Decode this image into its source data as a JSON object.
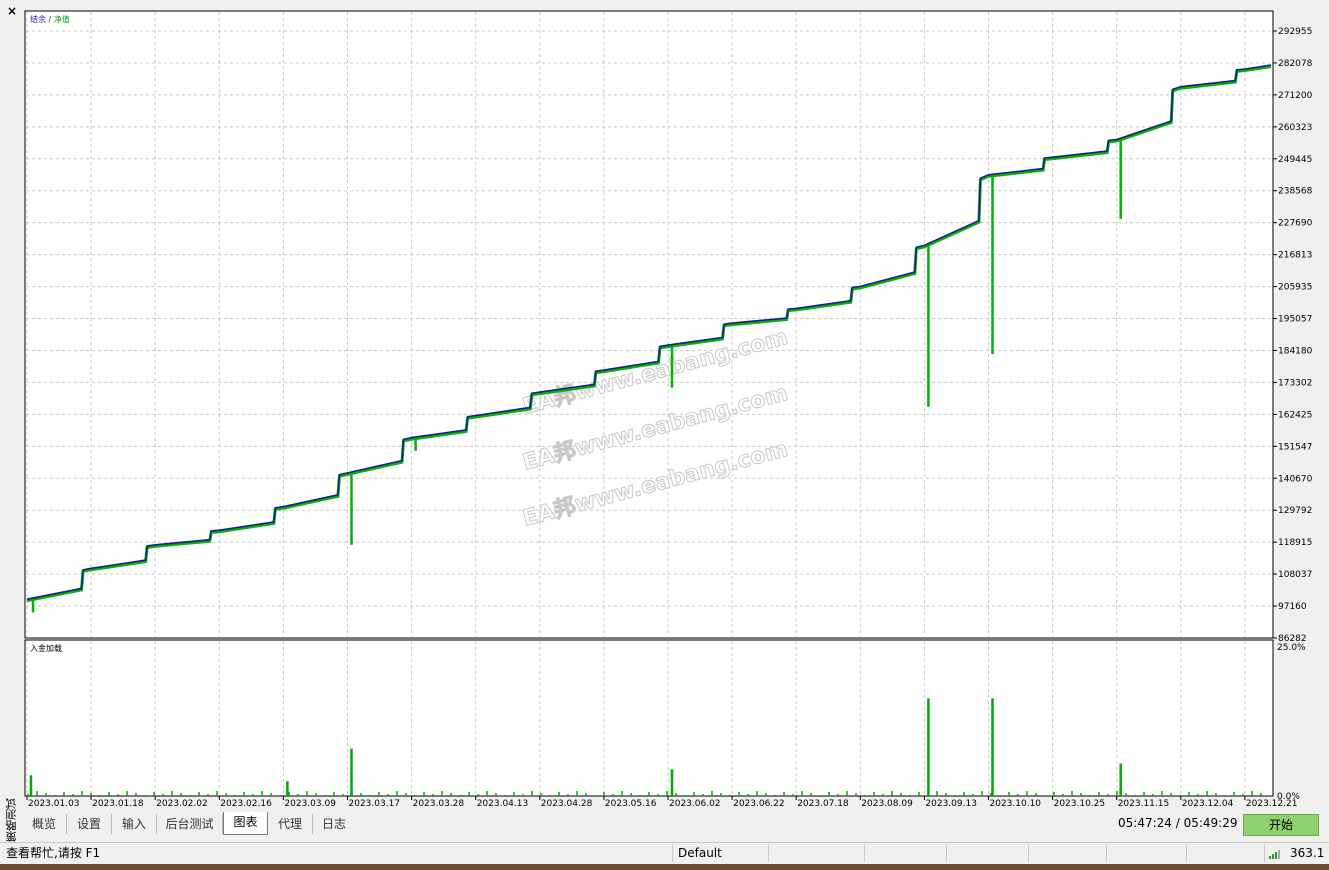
{
  "window": {
    "close_glyph": "×",
    "side_label": "策略测试"
  },
  "balance_chart": {
    "legend_balance": "结余",
    "legend_sep": " / ",
    "legend_equity": "净值",
    "y_ticks": [
      "292955",
      "282078",
      "271200",
      "260323",
      "249445",
      "238568",
      "227690",
      "216813",
      "205935",
      "195057",
      "184180",
      "173302",
      "162425",
      "151547",
      "140670",
      "129792",
      "118915",
      "108037",
      "97160",
      "86282"
    ]
  },
  "deposit_chart": {
    "title": "入金加载",
    "y_top": "25.0%",
    "y_bottom": "0.0%"
  },
  "x_ticks": [
    "2023.01.03",
    "2023.01.18",
    "2023.02.02",
    "2023.02.16",
    "2023.03.09",
    "2023.03.17",
    "2023.03.28",
    "2023.04.13",
    "2023.04.28",
    "2023.05.16",
    "2023.06.02",
    "2023.06.22",
    "2023.07.18",
    "2023.08.09",
    "2023.09.13",
    "2023.10.10",
    "2023.10.25",
    "2023.11.15",
    "2023.12.04",
    "2023.12.21"
  ],
  "watermark": [
    "EA邦www.eabang.com",
    "EA邦www.eabang.com",
    "EA邦www.eabang.com"
  ],
  "colors": {
    "balance": "#1a1a9a",
    "equity": "#00b400",
    "deposit": "#00aa00",
    "grid": "#c8c8c8",
    "start_button": "#8dd06d"
  },
  "tabs": [
    "概览",
    "设置",
    "输入",
    "后台测试",
    "图表",
    "代理",
    "日志"
  ],
  "active_tab": "图表",
  "time_readout": "05:47:24 / 05:49:29",
  "start_button": "开始",
  "statusbar": {
    "help": "查看帮忙,请按 F1",
    "profile": "Default",
    "signal": "363.1"
  },
  "chart_data": [
    {
      "type": "line",
      "title": "",
      "legend": [
        "结余",
        "净值"
      ],
      "ylim": [
        86282,
        292955
      ],
      "x_ticks": [
        "2023.01.03",
        "2023.01.18",
        "2023.02.02",
        "2023.02.16",
        "2023.03.09",
        "2023.03.17",
        "2023.03.28",
        "2023.04.13",
        "2023.04.28",
        "2023.05.16",
        "2023.06.02",
        "2023.06.22",
        "2023.07.18",
        "2023.08.09",
        "2023.09.13",
        "2023.10.10",
        "2023.10.25",
        "2023.11.15",
        "2023.12.04",
        "2023.12.21"
      ],
      "series": [
        {
          "name": "结余",
          "x": [
            "2023.01.03",
            "2023.01.18",
            "2023.02.02",
            "2023.02.16",
            "2023.03.09",
            "2023.03.17",
            "2023.03.28",
            "2023.04.13",
            "2023.04.28",
            "2023.05.16",
            "2023.06.02",
            "2023.06.22",
            "2023.07.18",
            "2023.08.09",
            "2023.09.13",
            "2023.10.10",
            "2023.10.25",
            "2023.11.15",
            "2023.12.04",
            "2023.12.21"
          ],
          "values": [
            99500,
            110000,
            118000,
            123000,
            131000,
            142500,
            154500,
            162000,
            170000,
            177500,
            186000,
            193500,
            198500,
            206000,
            220000,
            244000,
            250000,
            256000,
            274000,
            280000
          ]
        },
        {
          "name": "净值",
          "drawdown_lows": [
            {
              "x": "2023.01.03",
              "value": 95000
            },
            {
              "x": "2023.03.17",
              "value": 118000
            },
            {
              "x": "2023.03.28",
              "value": 150000
            },
            {
              "x": "2023.06.02",
              "value": 171500
            },
            {
              "x": "2023.09.13",
              "value": 165000
            },
            {
              "x": "2023.10.10",
              "value": 183000
            },
            {
              "x": "2023.11.15",
              "value": 229000
            }
          ]
        }
      ]
    },
    {
      "type": "bar",
      "title": "入金加载",
      "ylim": [
        0,
        25
      ],
      "unit": "%",
      "peaks": [
        {
          "x": "2023.01.03",
          "value": 3.5
        },
        {
          "x": "2023.03.09",
          "value": 2.5
        },
        {
          "x": "2023.03.17",
          "value": 8
        },
        {
          "x": "2023.06.02",
          "value": 4.5
        },
        {
          "x": "2023.09.13",
          "value": 16.5
        },
        {
          "x": "2023.10.10",
          "value": 16.5
        },
        {
          "x": "2023.11.15",
          "value": 5.5
        }
      ]
    }
  ]
}
